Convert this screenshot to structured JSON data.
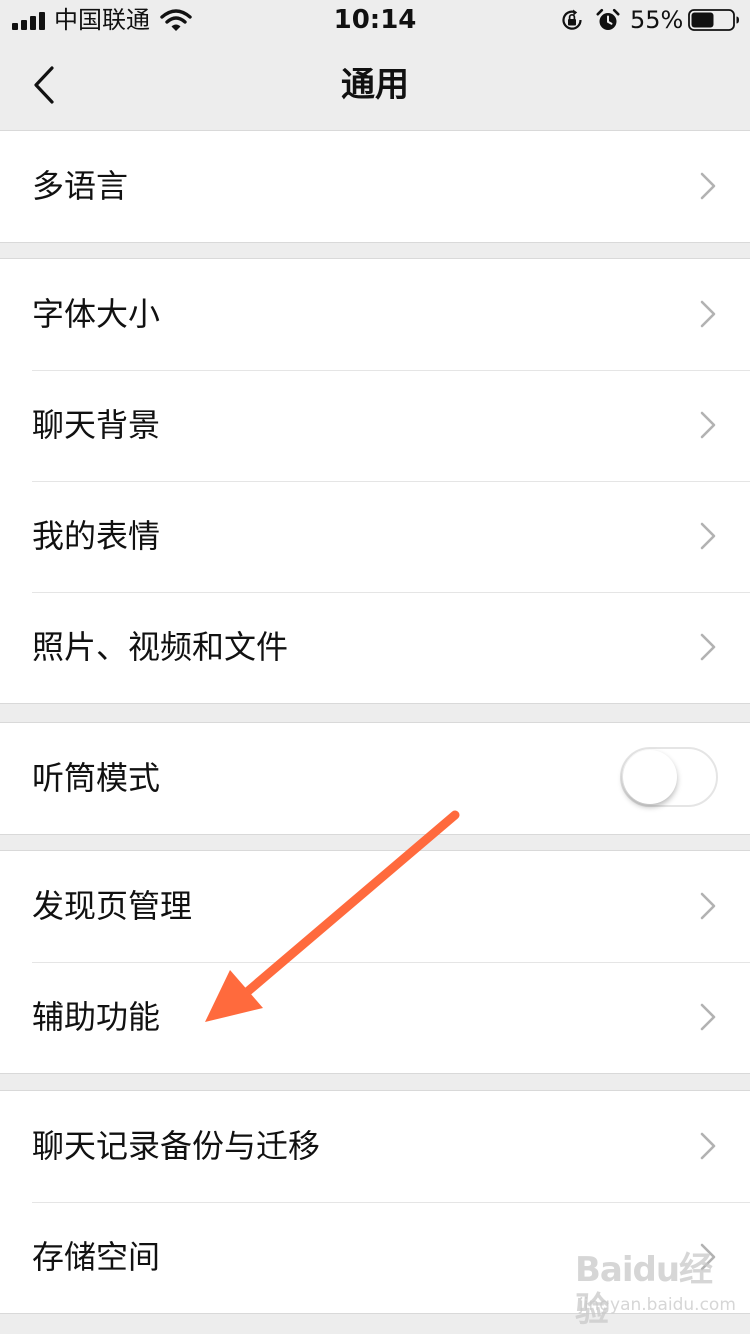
{
  "status_bar": {
    "carrier": "中国联通",
    "time": "10:14",
    "battery_percent": "55%",
    "battery_level": 0.55,
    "icons": [
      "signal-icon",
      "wifi-icon",
      "rotation-lock-icon",
      "alarm-icon",
      "battery-icon"
    ]
  },
  "nav": {
    "title": "通用",
    "back_icon": "chevron-left-icon"
  },
  "groups": [
    {
      "items": [
        {
          "label": "多语言",
          "type": "link"
        }
      ]
    },
    {
      "items": [
        {
          "label": "字体大小",
          "type": "link"
        },
        {
          "label": "聊天背景",
          "type": "link"
        },
        {
          "label": "我的表情",
          "type": "link"
        },
        {
          "label": "照片、视频和文件",
          "type": "link"
        }
      ]
    },
    {
      "items": [
        {
          "label": "听筒模式",
          "type": "toggle",
          "on": false
        }
      ]
    },
    {
      "items": [
        {
          "label": "发现页管理",
          "type": "link"
        },
        {
          "label": "辅助功能",
          "type": "link"
        }
      ]
    },
    {
      "items": [
        {
          "label": "聊天记录备份与迁移",
          "type": "link"
        },
        {
          "label": "存储空间",
          "type": "link"
        }
      ]
    }
  ],
  "annotation": {
    "type": "arrow",
    "color": "#ff6a3d",
    "points_to": "辅助功能"
  },
  "watermark": {
    "main": "Baidu经验",
    "sub": "jingyan.baidu.com"
  },
  "colors": {
    "background": "#ededed",
    "row_background": "#ffffff",
    "separator": "#e5e5e5",
    "chevron": "#b2b2b2",
    "text": "#111111"
  }
}
